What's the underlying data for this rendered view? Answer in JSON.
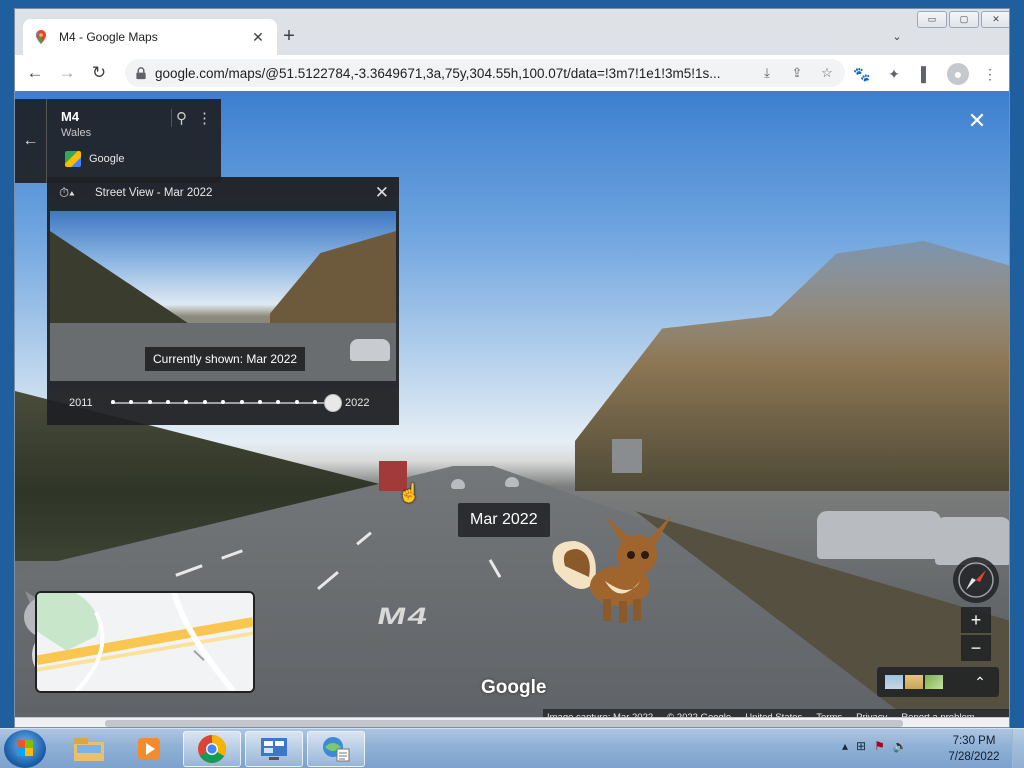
{
  "browser": {
    "tab": {
      "title": "M4 - Google Maps",
      "favicon": "google-maps-pin-icon",
      "close_glyph": "✕"
    },
    "new_tab_glyph": "+",
    "tab_search_glyph": "⌄",
    "window_buttons": {
      "minimize": "▭",
      "maximize": "▢",
      "close": "✕"
    },
    "nav": {
      "back": "←",
      "forward": "→",
      "reload": "↻"
    },
    "url": "google.com/maps/@51.5122784,-3.3649671,3a,75y,304.55h,100.07t/data=!3m7!1e1!3m5!1s...",
    "omnibox_icons": {
      "install": "⤓",
      "share": "⇪",
      "bookmark": "☆"
    },
    "extension_icons": {
      "paw": "🐾",
      "extensions": "✦",
      "sidepanel": "▌",
      "profile": "●",
      "menu": "⋮"
    }
  },
  "maps": {
    "info_card": {
      "title": "M4",
      "subtitle": "Wales",
      "source": "Google",
      "back_glyph": "←",
      "pin_glyph": "⚲",
      "more_glyph": "⋮"
    },
    "time_machine": {
      "title": "Street View - Mar 2022",
      "clock_glyph": "⏱▴",
      "close_glyph": "✕",
      "currently_shown": "Currently shown: Mar 2022",
      "year_start": "2011",
      "year_end": "2022",
      "timeline_points": 13,
      "selected_fraction": 1.0
    },
    "close_glyph": "✕",
    "date_chip": "Mar 2022",
    "road_marking": "M4",
    "zoom_in": "+",
    "zoom_out": "−",
    "layers_expand_glyph": "⌃",
    "google_logo": "Google",
    "footer": {
      "image_capture": "Image capture: Mar 2022",
      "copyright": "© 2022 Google",
      "country": "United States",
      "terms": "Terms",
      "privacy": "Privacy",
      "report": "Report a problem"
    }
  },
  "taskbar": {
    "items": [
      "windows-explorer-icon",
      "media-player-icon",
      "chrome-icon",
      "control-panel-icon",
      "network-tool-icon"
    ],
    "tray_icons": [
      "show-hidden-icons",
      "network-icon",
      "action-center-flag-icon",
      "volume-icon"
    ],
    "time": "7:30 PM",
    "date": "7/28/2022"
  },
  "colors": {
    "chrome_bg": "#dee1e6",
    "maps_panel": "#202124",
    "taskbar": "#8fb1d6"
  }
}
